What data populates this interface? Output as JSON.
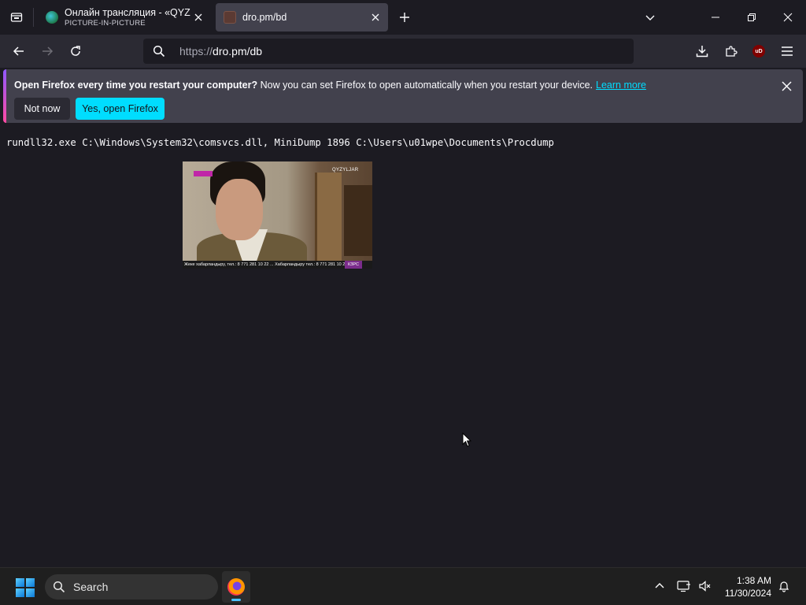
{
  "browser": {
    "tabs": [
      {
        "title": "Онлайн трансляция - «QYZYL",
        "subtitle": "PICTURE-IN-PICTURE",
        "active": false
      },
      {
        "title": "dro.pm/bd",
        "subtitle": "",
        "active": true
      }
    ],
    "url_prefix": "https://",
    "url_rest": "dro.pm/db",
    "extension_badge": "uD"
  },
  "notification": {
    "bold_text": "Open Firefox every time you restart your computer?",
    "text": " Now you can set Firefox to open automatically when you restart your device.",
    "link": "Learn more",
    "not_now": "Not now",
    "yes": "Yes, open Firefox"
  },
  "page": {
    "command": "rundll32.exe C:\\Windows\\System32\\comsvcs.dll, MiniDump 1896 C:\\Users\\u01wpe\\Documents\\Procdump",
    "video": {
      "channel_name": "QYZYLJAR",
      "ticker": "Жеке хабарландыру, тел.: 8 771 281 10 22 ... Хабарландыру тел.: 8 771 281 10 22",
      "ticker_badge": "КЗРС"
    }
  },
  "taskbar": {
    "search_label": "Search",
    "time": "1:38 AM",
    "date": "11/30/2024"
  },
  "colors": {
    "accent": "#00ddff",
    "background": "#1c1b22",
    "toolbar": "#2b2a33"
  }
}
